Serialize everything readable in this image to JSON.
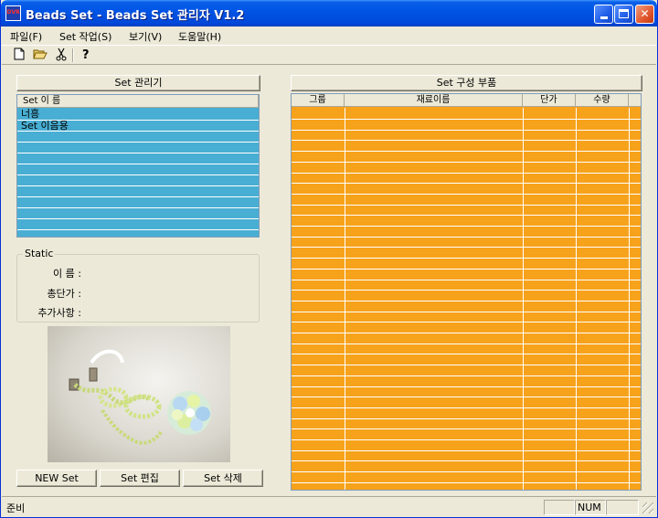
{
  "window": {
    "title": "Beads Set - Beads Set 관리자 V1.2",
    "icon_text": "DVR"
  },
  "menu": {
    "items": [
      "파일(F)",
      "Set 작업(S)",
      "보기(V)",
      "도움말(H)"
    ]
  },
  "toolbar": {
    "icons": [
      "new-file-icon",
      "open-folder-icon",
      "cut-icon",
      "help-icon"
    ]
  },
  "left_panel": {
    "manage_button": "Set 관리기",
    "list_header": "Set 이 름",
    "list_items": [
      "너흥",
      "Set 이음용"
    ],
    "list_color": "#49aed3",
    "groupbox_title": "Static",
    "fields": {
      "name_label": "이   름 :",
      "total_label": "총단가 :",
      "extra_label": "추가사항 :"
    },
    "buttons": {
      "new": "NEW Set",
      "edit": "Set 편집",
      "delete": "Set 삭제"
    }
  },
  "right_panel": {
    "parts_button": "Set 구성 부품",
    "columns": [
      "그룹",
      "재료이름",
      "단가",
      "수량"
    ],
    "grid_color": "#f7a21b"
  },
  "status": {
    "text": "준비",
    "num": "NUM"
  }
}
